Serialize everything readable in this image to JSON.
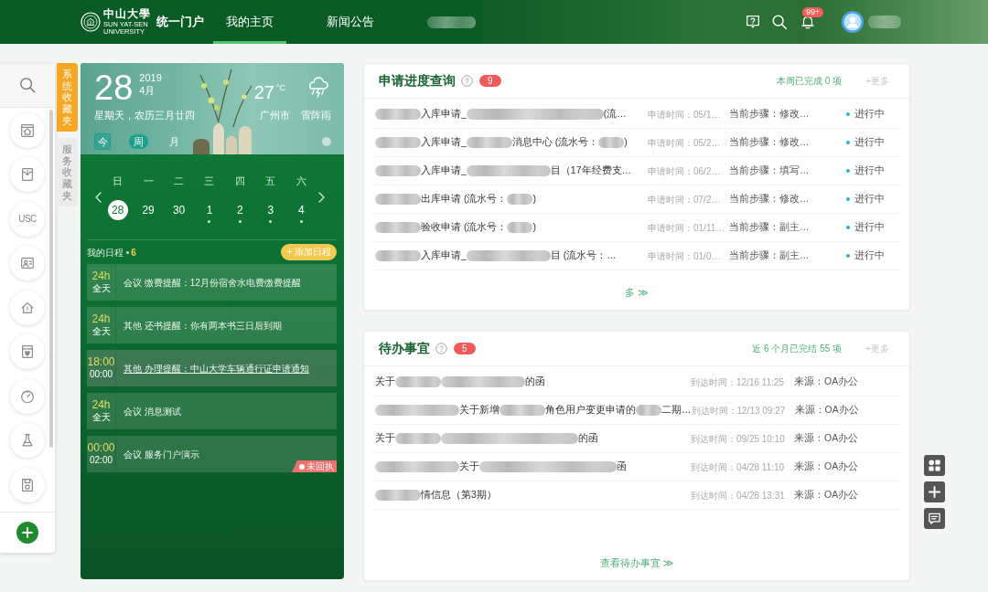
{
  "header": {
    "logo_name": "中山大學",
    "logo_subtitle": "SUN YAT-SEN UNIVERSITY",
    "portal_title": "统一门户",
    "nav": [
      {
        "kind": "text",
        "label": "我的主页",
        "selected": true
      },
      {
        "kind": "text",
        "label": "新闻公告",
        "selected": false
      },
      {
        "kind": "blur",
        "selected": false
      }
    ],
    "notification_badge": "99+"
  },
  "sidebar": {
    "items": [
      {
        "kind": "icon"
      },
      {
        "kind": "icon"
      },
      {
        "kind": "text",
        "label": "USC"
      },
      {
        "kind": "icon"
      },
      {
        "kind": "icon"
      },
      {
        "kind": "icon"
      },
      {
        "kind": "icon"
      },
      {
        "kind": "icon"
      },
      {
        "kind": "icon"
      }
    ]
  },
  "favorites_tabs": [
    {
      "label": "系统收藏夹",
      "selected": true
    },
    {
      "label": "服务收藏夹",
      "selected": false
    }
  ],
  "calendar": {
    "day": "28",
    "year": "2019",
    "month": "4月",
    "weekday_lunar": "星期天，农历三月廿四",
    "temperature": "27",
    "unit": "°C",
    "city": "广州市",
    "weather": "雷阵雨",
    "today_button": "今",
    "views": [
      {
        "label": "周",
        "selected": true
      },
      {
        "label": "月",
        "selected": false
      }
    ],
    "weekdays": [
      "日",
      "一",
      "二",
      "三",
      "四",
      "五",
      "六"
    ],
    "dates": [
      {
        "label": "28",
        "selected": true,
        "marked": false
      },
      {
        "label": "29",
        "selected": false,
        "marked": false
      },
      {
        "label": "30",
        "selected": false,
        "marked": false
      },
      {
        "label": "1",
        "selected": false,
        "marked": true
      },
      {
        "label": "2",
        "selected": false,
        "marked": true
      },
      {
        "label": "3",
        "selected": false,
        "marked": true
      },
      {
        "label": "4",
        "selected": false,
        "marked": true
      }
    ],
    "schedule": {
      "title": "我的日程 •",
      "count": "6",
      "add_button": "+ 添加日程"
    },
    "events": [
      {
        "time": "24h",
        "duration": "全天",
        "text": "会议 缴费提醒：12月份宿舍水电费缴费提醒",
        "highlighted": false
      },
      {
        "time": "24h",
        "duration": "全天",
        "text": "其他 还书提醒：你有两本书三日后到期",
        "highlighted": false
      },
      {
        "time": "18:00",
        "duration": "00:00",
        "text": "其他 办理提醒：中山大学车辆通行证申请通知",
        "highlighted": true
      },
      {
        "time": "24h",
        "duration": "全天",
        "text": "会议 消息测试",
        "highlighted": false
      },
      {
        "time": "00:00",
        "duration": "02:00",
        "text": "会议 服务门户演示",
        "highlighted": false,
        "tag": "未回执"
      }
    ]
  },
  "applications": {
    "title": "申请进度查询",
    "badge": "9",
    "summary": "本周已完成 0 项",
    "more": "+更多",
    "rows": [
      {
        "title": [
          {
            "kind": "blur"
          },
          {
            "kind": "text",
            "text": "入库申请_"
          },
          {
            "kind": "blur-xlong"
          },
          {
            "kind": "text",
            "text": "(流…"
          }
        ],
        "time": "申请时间：05/1…",
        "step": "当前步骤：修改…",
        "status": "进行中"
      },
      {
        "title": [
          {
            "kind": "blur"
          },
          {
            "kind": "text",
            "text": "入库申请_"
          },
          {
            "kind": "blur"
          },
          {
            "kind": "text",
            "text": "消息中心 (流水号："
          },
          {
            "kind": "blur-short"
          },
          {
            "kind": "text",
            "text": ")"
          }
        ],
        "time": "申请时间：05/2…",
        "step": "当前步骤：修改…",
        "status": "进行中"
      },
      {
        "title": [
          {
            "kind": "blur"
          },
          {
            "kind": "text",
            "text": "入库申请_"
          },
          {
            "kind": "blur-long"
          },
          {
            "kind": "text",
            "text": "目（17年经费支…"
          }
        ],
        "time": "申请时间：06/2…",
        "step": "当前步骤：填写…",
        "status": "进行中"
      },
      {
        "title": [
          {
            "kind": "blur"
          },
          {
            "kind": "text",
            "text": "出库申请 (流水号："
          },
          {
            "kind": "blur-short"
          },
          {
            "kind": "text",
            "text": ")"
          }
        ],
        "time": "申请时间：07/2…",
        "step": "当前步骤：修改…",
        "status": "进行中"
      },
      {
        "title": [
          {
            "kind": "blur"
          },
          {
            "kind": "text",
            "text": "验收申请 (流水号："
          },
          {
            "kind": "blur-short"
          },
          {
            "kind": "text",
            "text": ")"
          }
        ],
        "time": "申请时间：01/11…",
        "step": "当前步骤：副主…",
        "status": "进行中"
      },
      {
        "title": [
          {
            "kind": "blur"
          },
          {
            "kind": "text",
            "text": "入库申请_"
          },
          {
            "kind": "blur-long"
          },
          {
            "kind": "text",
            "text": "目 (流水号：…"
          }
        ],
        "time": "申请时间：01/0…",
        "step": "当前步骤：副主…",
        "status": "进行中"
      }
    ],
    "footer": "多 ≫"
  },
  "todos": {
    "title": "待办事宜",
    "badge": "5",
    "summary": "近 6 个月已完结 55 项",
    "more": "+更多",
    "rows": [
      {
        "title": [
          {
            "kind": "text",
            "text": "关于"
          },
          {
            "kind": "blur"
          },
          {
            "kind": "blur-long"
          },
          {
            "kind": "text",
            "text": "的函"
          }
        ],
        "time": "到达时间：12/16 11:25",
        "source": "来源：OA办公"
      },
      {
        "title": [
          {
            "kind": "blur-long"
          },
          {
            "kind": "text",
            "text": "关于新增"
          },
          {
            "kind": "blur"
          },
          {
            "kind": "text",
            "text": "角色用户变更申请的"
          },
          {
            "kind": "blur-short"
          },
          {
            "kind": "text",
            "text": "二期…"
          }
        ],
        "time": "到达时间：12/13 09:27",
        "source": "来源：OA办公"
      },
      {
        "title": [
          {
            "kind": "text",
            "text": "关于"
          },
          {
            "kind": "blur"
          },
          {
            "kind": "blur-xlong"
          },
          {
            "kind": "text",
            "text": "的函"
          }
        ],
        "time": "到达时间：09/25 10:10",
        "source": "来源：OA办公"
      },
      {
        "title": [
          {
            "kind": "blur-long"
          },
          {
            "kind": "text",
            "text": "关于"
          },
          {
            "kind": "blur-xlong"
          },
          {
            "kind": "text",
            "text": "函"
          }
        ],
        "time": "到达时间：04/28 11:10",
        "source": "来源：OA办公"
      },
      {
        "title": [
          {
            "kind": "blur"
          },
          {
            "kind": "text",
            "text": "情信息（第3期）"
          }
        ],
        "time": "到达时间：04/28 13:31",
        "source": "来源：OA办公"
      }
    ],
    "footer": "查看待办事宜 ≫"
  }
}
